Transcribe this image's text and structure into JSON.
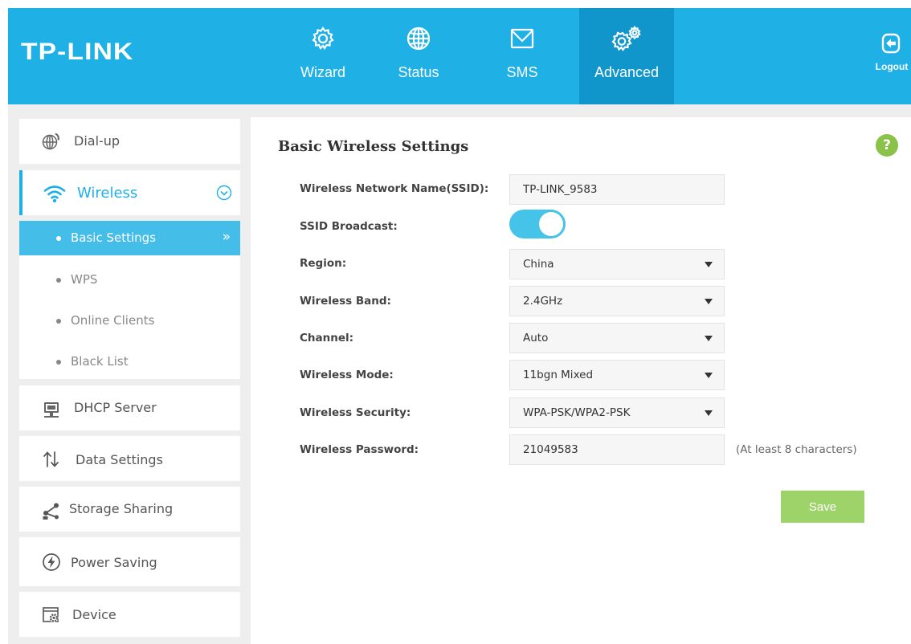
{
  "header": {
    "logo": "TP-LINK",
    "nav": [
      {
        "label": "Wizard",
        "icon": "gear-icon"
      },
      {
        "label": "Status",
        "icon": "globe-icon"
      },
      {
        "label": "SMS",
        "icon": "envelope-icon"
      },
      {
        "label": "Advanced",
        "icon": "double-gear-icon",
        "active": true
      }
    ],
    "logout": {
      "label": "Logout",
      "icon": "logout-icon"
    }
  },
  "sidebar": {
    "items": [
      {
        "label": "Dial-up",
        "icon": "globe-phone-icon"
      },
      {
        "label": "Wireless",
        "icon": "wifi-icon",
        "expanded": true
      },
      {
        "label": "DHCP Server",
        "icon": "dhcp-monitor-icon"
      },
      {
        "label": "Data Settings",
        "icon": "up-down-arrows-icon"
      },
      {
        "label": "Storage Sharing",
        "icon": "share-icon"
      },
      {
        "label": "Power Saving",
        "icon": "power-shield-icon"
      },
      {
        "label": "Device",
        "icon": "device-gear-icon"
      }
    ],
    "wireless_sub": [
      {
        "label": "Basic Settings",
        "active": true
      },
      {
        "label": "WPS"
      },
      {
        "label": "Online Clients"
      },
      {
        "label": "Black List"
      }
    ],
    "active_arrow": "»"
  },
  "main": {
    "title": "Basic Wireless Settings",
    "help": "?",
    "fields": {
      "ssid": {
        "label": "Wireless Network Name(SSID):",
        "value": "TP-LINK_9583"
      },
      "broadcast": {
        "label": "SSID Broadcast:",
        "on": true
      },
      "region": {
        "label": "Region:",
        "value": "China"
      },
      "band": {
        "label": "Wireless Band:",
        "value": "2.4GHz"
      },
      "channel": {
        "label": "Channel:",
        "value": "Auto"
      },
      "mode": {
        "label": "Wireless Mode:",
        "value": "11bgn Mixed"
      },
      "security": {
        "label": "Wireless Security:",
        "value": "WPA-PSK/WPA2-PSK"
      },
      "password": {
        "label": "Wireless Password:",
        "value": "21049583",
        "hint": "(At least 8 characters)"
      }
    },
    "save_label": "Save"
  },
  "colors": {
    "header": "#1fb0e6",
    "header_active": "#1196cc",
    "accent": "#44bde8",
    "save": "#9ed36a",
    "help": "#8bc34a"
  }
}
